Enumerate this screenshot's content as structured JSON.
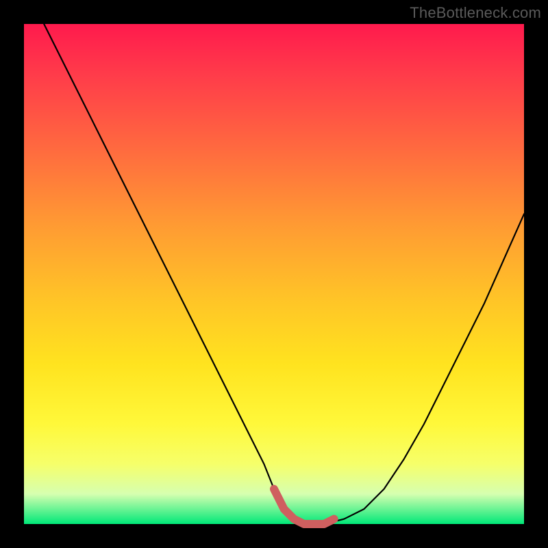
{
  "watermark": "TheBottleneck.com",
  "chart_data": {
    "type": "line",
    "title": "",
    "xlabel": "",
    "ylabel": "",
    "xlim": [
      0,
      100
    ],
    "ylim": [
      0,
      100
    ],
    "grid": false,
    "legend": false,
    "series": [
      {
        "name": "bottleneck-curve",
        "x": [
          4,
          8,
          12,
          16,
          20,
          24,
          28,
          32,
          36,
          40,
          44,
          48,
          50,
          52,
          54,
          56,
          58,
          60,
          64,
          68,
          72,
          76,
          80,
          84,
          88,
          92,
          96,
          100
        ],
        "y": [
          100,
          92,
          84,
          76,
          68,
          60,
          52,
          44,
          36,
          28,
          20,
          12,
          7,
          3,
          1,
          0,
          0,
          0,
          1,
          3,
          7,
          13,
          20,
          28,
          36,
          44,
          53,
          62
        ]
      }
    ],
    "highlight_segment": {
      "name": "optimal-range",
      "x": [
        50,
        52,
        54,
        56,
        58,
        60,
        62
      ],
      "y": [
        7,
        3,
        1,
        0,
        0,
        0,
        1
      ]
    },
    "gradient_stops": [
      {
        "pos": 0.0,
        "color": "#ff1a4d"
      },
      {
        "pos": 0.25,
        "color": "#ff6a3f"
      },
      {
        "pos": 0.55,
        "color": "#ffc427"
      },
      {
        "pos": 0.8,
        "color": "#fff83a"
      },
      {
        "pos": 1.0,
        "color": "#00e878"
      }
    ]
  }
}
